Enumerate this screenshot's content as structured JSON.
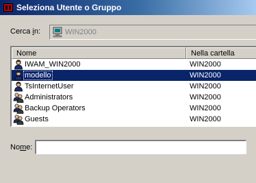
{
  "window": {
    "title": "Seleziona Utente o Gruppo"
  },
  "search_in": {
    "label_prefix": "Cerca ",
    "label_mnemonic": "i",
    "label_suffix": "n:",
    "value": "WIN2000"
  },
  "list": {
    "columns": [
      "Nome",
      "Nella cartella"
    ],
    "rows": [
      {
        "name": "IWAM_WIN2000",
        "folder": "WIN2000",
        "icon": "user-icon",
        "selected": false
      },
      {
        "name": "modello",
        "folder": "WIN2000",
        "icon": "user-icon",
        "selected": true
      },
      {
        "name": "TsInternetUser",
        "folder": "WIN2000",
        "icon": "user-icon",
        "selected": false
      },
      {
        "name": "Administrators",
        "folder": "WIN2000",
        "icon": "group-icon",
        "selected": false
      },
      {
        "name": "Backup Operators",
        "folder": "WIN2000",
        "icon": "group-icon",
        "selected": false
      },
      {
        "name": "Guests",
        "folder": "WIN2000",
        "icon": "group-icon",
        "selected": false
      }
    ]
  },
  "name_field": {
    "label_prefix": "No",
    "label_mnemonic": "m",
    "label_suffix": "e:",
    "value": ""
  },
  "colors": {
    "selection": "#0a246a",
    "face": "#d4d0c8"
  }
}
